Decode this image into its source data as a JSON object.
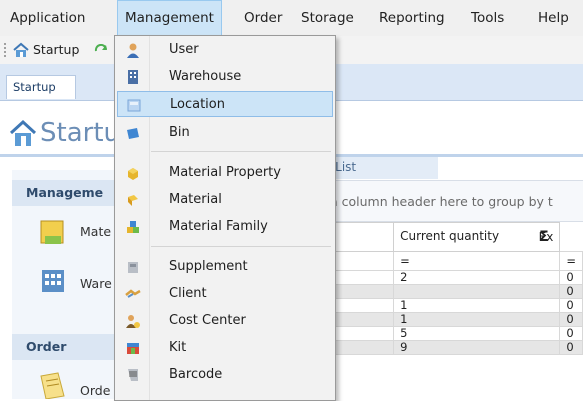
{
  "menubar": {
    "items": [
      {
        "label": "Application"
      },
      {
        "label": "Management"
      },
      {
        "label": "Order"
      },
      {
        "label": "Storage"
      },
      {
        "label": "Reporting"
      },
      {
        "label": "Tools"
      },
      {
        "label": "Help"
      }
    ]
  },
  "toolbar": {
    "startup_label": "Startup"
  },
  "tabs": [
    {
      "label": "Startup"
    }
  ],
  "page": {
    "title": "Startu"
  },
  "left_panel": {
    "groups": [
      {
        "title": "Manageme",
        "items": [
          {
            "label": "Mate"
          },
          {
            "label": "Ware"
          }
        ]
      },
      {
        "title": "Order",
        "items": [
          {
            "label": "Orde"
          }
        ]
      }
    ]
  },
  "grid": {
    "caption": "l List",
    "group_hint": "a column header here to group by t",
    "columns": [
      "al",
      "Current quantity",
      "Σ",
      "Ex"
    ],
    "filter_symbol": "=",
    "rows": [
      {
        "qty": "2",
        "ex": "0"
      },
      {
        "qty": "",
        "ex": "0"
      },
      {
        "qty": "1",
        "ex": "0"
      },
      {
        "qty": "1",
        "ex": "0"
      },
      {
        "qty": "5",
        "ex": "0"
      },
      {
        "qty": "9",
        "ex": "0"
      }
    ]
  },
  "dropdown": {
    "items": [
      {
        "label": "User",
        "icon": "user-icon"
      },
      {
        "label": "Warehouse",
        "icon": "warehouse-icon"
      },
      {
        "label": "Location",
        "icon": "location-icon",
        "highlighted": true
      },
      {
        "label": "Bin",
        "icon": "bin-icon"
      },
      {
        "label": "Material Property",
        "icon": "material-property-icon"
      },
      {
        "label": "Material",
        "icon": "material-icon"
      },
      {
        "label": "Material Family",
        "icon": "material-family-icon"
      },
      {
        "label": "Supplement",
        "icon": "supplement-icon"
      },
      {
        "label": "Client",
        "icon": "client-icon"
      },
      {
        "label": "Cost Center",
        "icon": "cost-center-icon"
      },
      {
        "label": "Kit",
        "icon": "kit-icon"
      },
      {
        "label": "Barcode",
        "icon": "barcode-icon"
      }
    ]
  },
  "colors": {
    "menu_highlight": "#cce4f7",
    "menu_highlight_border": "#99c9ef",
    "tabstrip": "#dbe7f6",
    "title": "#6c8eb6"
  }
}
